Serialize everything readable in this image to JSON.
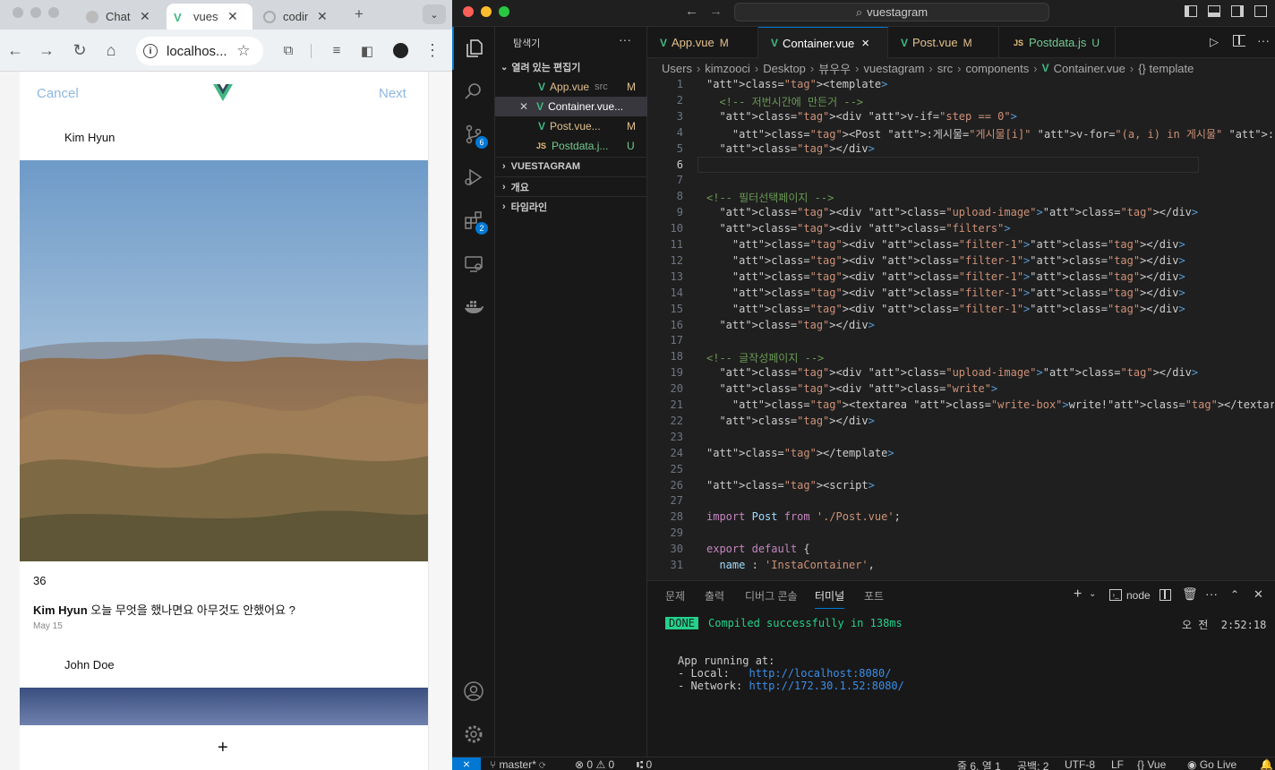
{
  "browser": {
    "tabs": [
      {
        "title": "ChatG",
        "icon": "chatgpt-icon"
      },
      {
        "title": "vuest",
        "icon": "vue-icon"
      },
      {
        "title": "codin",
        "icon": "globe-icon"
      }
    ],
    "new_tab": "+",
    "url": "localhos..."
  },
  "app": {
    "cancel": "Cancel",
    "next": "Next",
    "post1": {
      "author": "Kim Hyun",
      "likes": "36",
      "caption_author": "Kim Hyun",
      "caption": "오늘 무엇을 했나면요 아무것도 안했어요 ?",
      "date": "May 15"
    },
    "post2": {
      "author": "John Doe"
    },
    "add": "+"
  },
  "vscode": {
    "title": "vuestagram",
    "sidebar": {
      "header": "탐색기",
      "open_editors": "열려 있는 편집기",
      "open_files": [
        {
          "name": "App.vue",
          "extra": "src",
          "status": "M",
          "type": "vue"
        },
        {
          "name": "Container.vue...",
          "extra": "",
          "status": "",
          "type": "vue"
        },
        {
          "name": "Post.vue...",
          "extra": "",
          "status": "M",
          "type": "vue"
        },
        {
          "name": "Postdata.j...",
          "extra": "",
          "status": "U",
          "type": "js"
        }
      ],
      "sections": [
        "VUESTAGRAM",
        "개요",
        "타임라인"
      ]
    },
    "tabs": [
      {
        "name": "App.vue",
        "status": "M",
        "type": "vue"
      },
      {
        "name": "Container.vue",
        "status": "×",
        "type": "vue"
      },
      {
        "name": "Post.vue",
        "status": "M",
        "type": "vue"
      },
      {
        "name": "Postdata.js",
        "status": "U",
        "type": "js"
      }
    ],
    "breadcrumb": [
      "Users",
      "kimzooci",
      "Desktop",
      "뷰우우",
      "vuestagram",
      "src",
      "components",
      "Container.vue",
      "{} template"
    ],
    "code_lines": [
      {
        "n": "1",
        "t": "<template>"
      },
      {
        "n": "2",
        "t": "  <!-- 저번시간에 만든거 -->"
      },
      {
        "n": "3",
        "t": "  <div v-if=\"step == 0\">"
      },
      {
        "n": "4",
        "t": "    <Post :게시물=\"게시물[i]\" v-for=\"(a, i) in 게시물\" :key=\"i\" />"
      },
      {
        "n": "5",
        "t": "  </div>"
      },
      {
        "n": "6",
        "t": ""
      },
      {
        "n": "7",
        "t": ""
      },
      {
        "n": "8",
        "t": "<!-- 필터선택페이지 -->"
      },
      {
        "n": "9",
        "t": "  <div class=\"upload-image\"></div>"
      },
      {
        "n": "10",
        "t": "  <div class=\"filters\">"
      },
      {
        "n": "11",
        "t": "    <div class=\"filter-1\"></div>"
      },
      {
        "n": "12",
        "t": "    <div class=\"filter-1\"></div>"
      },
      {
        "n": "13",
        "t": "    <div class=\"filter-1\"></div>"
      },
      {
        "n": "14",
        "t": "    <div class=\"filter-1\"></div>"
      },
      {
        "n": "15",
        "t": "    <div class=\"filter-1\"></div>"
      },
      {
        "n": "16",
        "t": "  </div>"
      },
      {
        "n": "17",
        "t": ""
      },
      {
        "n": "18",
        "t": "<!-- 글작성페이지 -->"
      },
      {
        "n": "19",
        "t": "  <div class=\"upload-image\"></div>"
      },
      {
        "n": "20",
        "t": "  <div class=\"write\">"
      },
      {
        "n": "21",
        "t": "    <textarea class=\"write-box\">write!</textarea>"
      },
      {
        "n": "22",
        "t": "  </div>"
      },
      {
        "n": "23",
        "t": ""
      },
      {
        "n": "24",
        "t": "</template>"
      },
      {
        "n": "25",
        "t": ""
      },
      {
        "n": "26",
        "t": "<script>"
      },
      {
        "n": "27",
        "t": ""
      },
      {
        "n": "28",
        "t": "import Post from './Post.vue';"
      },
      {
        "n": "29",
        "t": ""
      },
      {
        "n": "30",
        "t": "export default {"
      },
      {
        "n": "31",
        "t": "  name : 'InstaContainer',"
      }
    ],
    "panel": {
      "tabs": [
        "문제",
        "출력",
        "디버그 콘솔",
        "터미널",
        "포트"
      ],
      "active_tab": "터미널",
      "shell": "node",
      "done": "DONE",
      "compiled": "Compiled successfully in 138ms",
      "time": "오 전  2:52:18",
      "running": "App running at:",
      "local_label": "- Local:   ",
      "local_url": "http://localhost:8080/",
      "network_label": "- Network: ",
      "network_url": "http://172.30.1.52:8080/"
    },
    "status": {
      "branch": "master*",
      "errors": "0",
      "warnings": "0",
      "ports": "0",
      "position": "줄 6, 열 1",
      "spaces": "공백: 2",
      "encoding": "UTF-8",
      "eol": "LF",
      "language": "Vue",
      "golive": "Go Live"
    },
    "badges": {
      "scm": "6",
      "extensions": "2"
    }
  },
  "colors": {
    "vue_green": "#41b883",
    "vs_accent": "#0078d4",
    "link_blue": "#8fb7e0"
  }
}
